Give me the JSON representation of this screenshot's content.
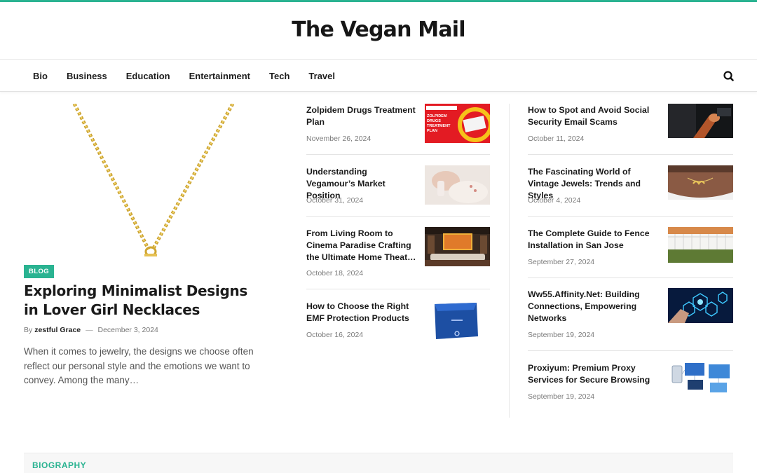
{
  "site": {
    "title": "The Vegan Mail",
    "accent_color": "#2ab391"
  },
  "nav": {
    "items": [
      "Bio",
      "Business",
      "Education",
      "Entertainment",
      "Tech",
      "Travel"
    ],
    "search_icon": "search-icon"
  },
  "featured": {
    "category": "BLOG",
    "title": "Exploring Minimalist Designs in Lover Girl Necklaces",
    "by_label": "By",
    "author": "zestful Grace",
    "separator": "—",
    "date": "December 3, 2024",
    "excerpt": "When it comes to jewelry, the designs we choose often reflect our personal style and the emotions we want to convey. Among the many…"
  },
  "middle_posts": [
    {
      "title": "Zolpidem Drugs Treatment Plan",
      "date": "November 26, 2024"
    },
    {
      "title": "Understanding Vegamour’s Market Position",
      "date": "October 31, 2024"
    },
    {
      "title": "From Living Room to Cinema Paradise Crafting the Ultimate Home Theat…",
      "date": "October 18, 2024"
    },
    {
      "title": "How to Choose the Right EMF Protection Products",
      "date": "October 16, 2024"
    }
  ],
  "right_posts": [
    {
      "title": "How to Spot and Avoid Social Security Email Scams",
      "date": "October 11, 2024"
    },
    {
      "title": "The Fascinating World of Vintage Jewels: Trends and Styles",
      "date": "October 4, 2024"
    },
    {
      "title": "The Complete Guide to Fence Installation in San Jose",
      "date": "September 27, 2024"
    },
    {
      "title": "Ww55.Affinity.Net: Building Connections, Empowering Networks",
      "date": "September 19, 2024"
    },
    {
      "title": "Proxiyum: Premium Proxy Services for Secure Browsing",
      "date": "September 19, 2024"
    }
  ],
  "thumb_text": {
    "zolpidem": [
      "ZOLPIDEM",
      "DRUGS",
      "TREATMENT",
      "PLAN"
    ]
  },
  "section": {
    "label": "BIOGRAPHY"
  }
}
